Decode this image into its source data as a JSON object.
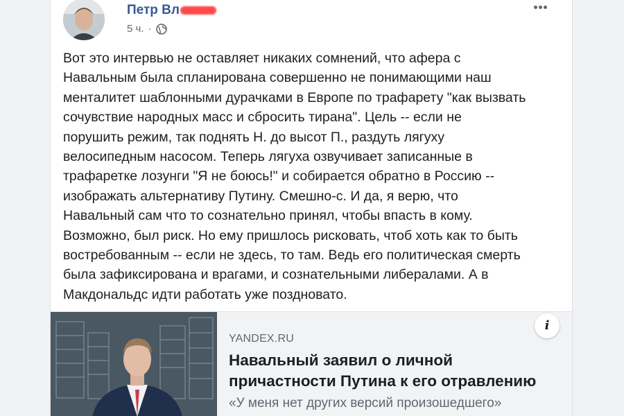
{
  "post": {
    "author": "Петр Вл",
    "time": "5 ч.",
    "separator": "·",
    "privacy_icon": "globe-icon",
    "more_icon": "more-dots-icon",
    "text_lines": [
      "Вот это интервью не оставляет никаких сомнений, что афера с",
      "Навальным была спланирована совершенно не понимающими наш",
      "менталитет шаблонными дурачками в Европе по трафарету \"как вызвать",
      "сочувствие народных масс и сбросить тирана\". Цель -- если не",
      "порушить режим, так поднять Н. до высот П., раздуть лягуху",
      "велосипедным насосом. Теперь лягуха озвучивает записанные в",
      "трафаретке лозунги \"Я не боюсь!\" и собирается обратно в Россию --",
      "изображать альтернативу Путину. Смешно-с. И да, я верю, что",
      "Навальный сам что то сознательно принял, чтобы впасть в кому.",
      "Возможно, был риск. Но ему пришлось рисковать, чтоб хоть как то быть",
      "востребованным -- если не здесь, то там. Ведь его политическая смерть",
      "была зафиксирована и врагами, и сознательными либералами. А в",
      "Макдональдс идти работать уже поздновато."
    ]
  },
  "link_preview": {
    "domain": "YANDEX.RU",
    "headline_line1": "Навальный заявил о личной",
    "headline_line2": "причастности Путина к его отравлению",
    "subtitle": "«У меня нет других версий произошедшего»",
    "info_label": "i",
    "info_icon": "info-icon"
  },
  "colors": {
    "author_link": "#385898",
    "text": "#1c1e21",
    "muted": "#606770",
    "card_bg": "#ffffff",
    "page_bg": "#f0f2f5",
    "preview_bg": "#f2f3f5"
  }
}
